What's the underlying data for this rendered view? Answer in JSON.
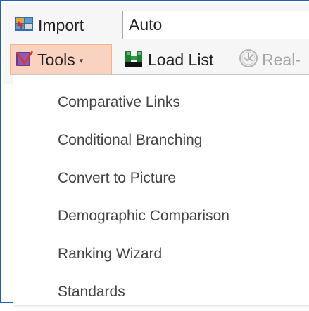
{
  "toolbar": {
    "import_label": "Import",
    "auto_value": "Auto",
    "tools_label": "Tools",
    "tools_arrow": "▾",
    "load_list_label": "Load List",
    "realtime_label": "Real-"
  },
  "icons": {
    "import": "import-icon",
    "tools": "tools-icon",
    "load_list": "load-list-icon",
    "realtime": "clock-icon"
  },
  "colors": {
    "frame_border": "#1f5fbf",
    "tools_active_bg": "#f9d3bf",
    "disabled_text": "#a6a6a6"
  },
  "menu": {
    "items": [
      {
        "label": "Comparative Links"
      },
      {
        "label": "Conditional Branching"
      },
      {
        "label": "Convert to Picture"
      },
      {
        "label": "Demographic Comparison"
      },
      {
        "label": "Ranking Wizard"
      },
      {
        "label": "Standards"
      }
    ]
  }
}
